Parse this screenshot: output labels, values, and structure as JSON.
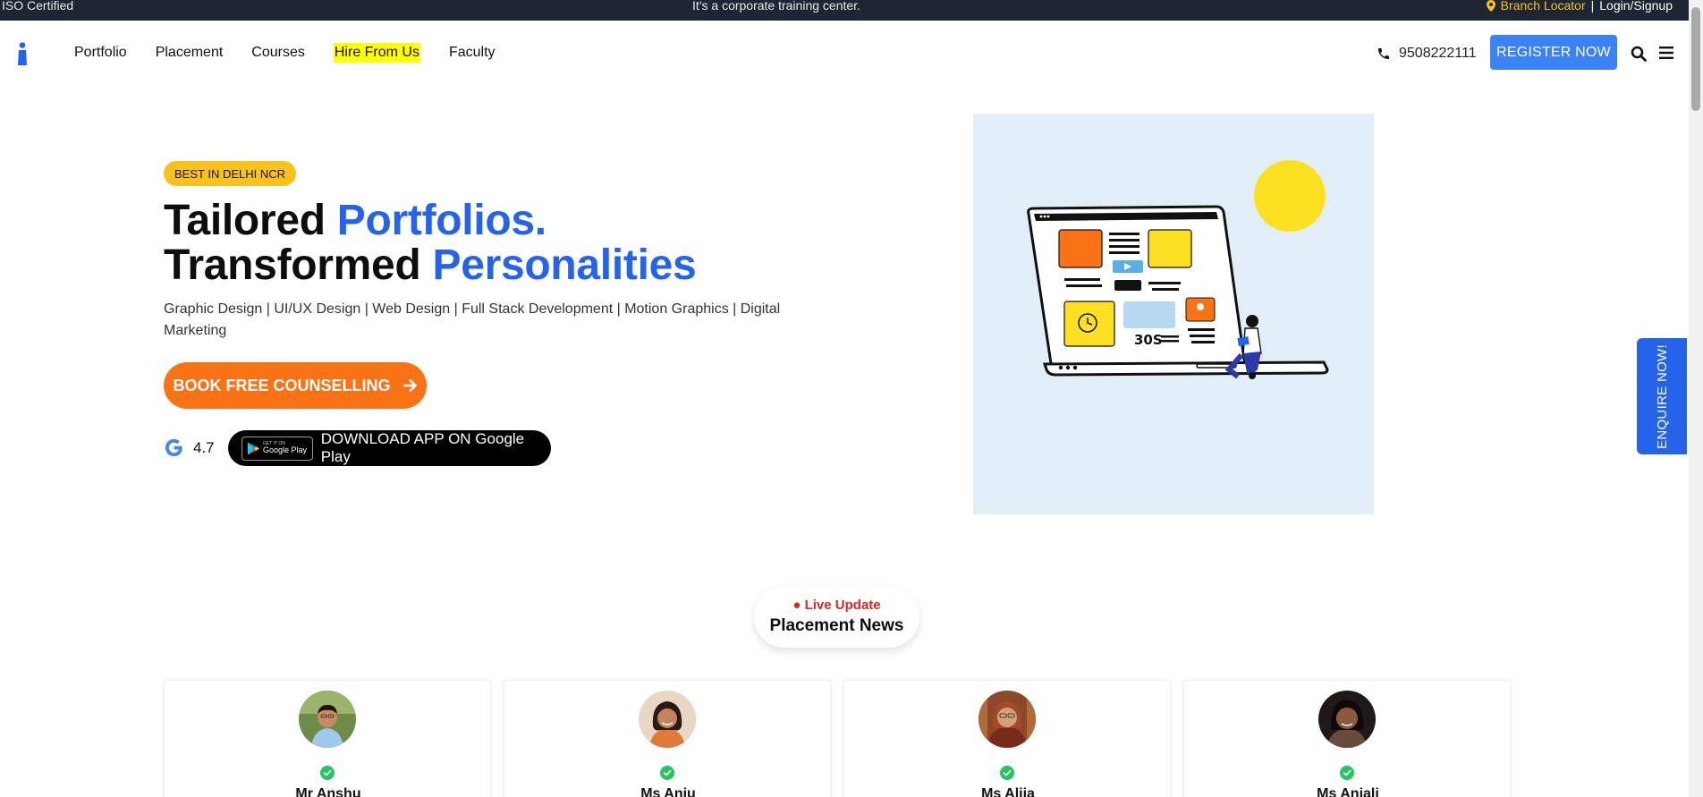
{
  "topbar": {
    "iso": "ISO Certified",
    "tagline": "It's a corporate training center.",
    "branch_locator": "Branch Locator",
    "separator": "|",
    "login": "Login/Signup",
    "accent": "#f8c21a"
  },
  "nav": {
    "items": [
      {
        "label": "Portfolio"
      },
      {
        "label": "Placement"
      },
      {
        "label": "Courses"
      },
      {
        "label": "Hire From Us",
        "highlight": true
      },
      {
        "label": "Faculty"
      }
    ],
    "phone": "9508222111",
    "register": "REGISTER NOW",
    "register_color": "#3b82f6"
  },
  "hero": {
    "badge": "BEST IN DELHI NCR",
    "line1_dark": "Tailored ",
    "line1_blue": "Portfolios.",
    "line2_dark": "Transformed ",
    "line2_blue": "Personalities",
    "subtitle": "Graphic Design | UI/UX Design | Web Design | Full Stack Development | Motion Graphics | Digital Marketing",
    "cta": "BOOK FREE COUNSELLING",
    "rating": "4.7",
    "app_button": "DOWNLOAD APP ON Google Play",
    "gp_badge_small": "GET IT ON",
    "gp_badge_big": "Google Play",
    "illustration_text": "30S",
    "accent_blue": "#2563eb",
    "accent_orange": "#f97316"
  },
  "enquire": "ENQUIRE NOW!",
  "placement": {
    "live": "● Live Update",
    "title": "Placement News",
    "cards": [
      {
        "name": "Mr Anshu"
      },
      {
        "name": "Ms Anju"
      },
      {
        "name": "Ms Alija"
      },
      {
        "name": "Ms Anjali"
      }
    ]
  }
}
